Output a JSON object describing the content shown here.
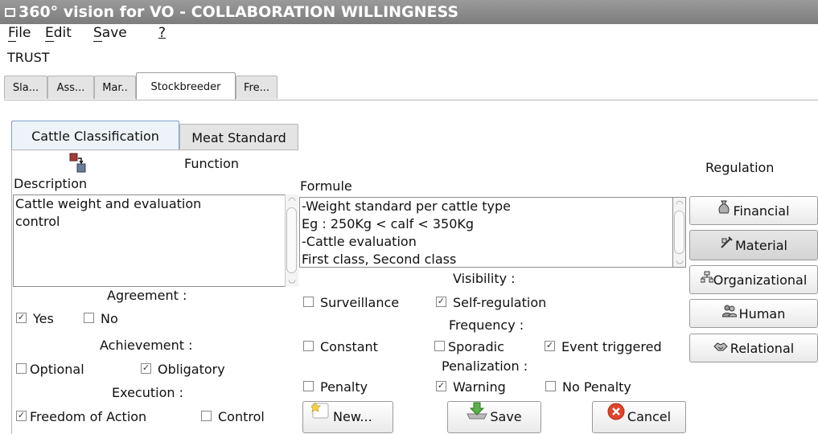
{
  "window": {
    "title": "360° vision for VO - COLLABORATION WILLINGNESS"
  },
  "menu": {
    "file": "File",
    "edit": "Edit",
    "save": "Save",
    "help": "?"
  },
  "section_title": "TRUST",
  "actor_tabs": [
    "Sla...",
    "Ass...",
    "Mar..",
    "Stockbreeder",
    "Fre..."
  ],
  "rule_tabs": [
    "Cattle Classification",
    "Meat Standard"
  ],
  "left": {
    "function_label": "Function",
    "description_label": "Description",
    "description_text": "Cattle weight and evaluation\ncontrol",
    "agreement_label": "Agreement :",
    "agreement": [
      {
        "label": "Yes",
        "checked": true
      },
      {
        "label": "No",
        "checked": false
      }
    ],
    "achievement_label": "Achievement :",
    "achievement": [
      {
        "label": "Optional",
        "checked": false
      },
      {
        "label": "Obligatory",
        "checked": true
      }
    ],
    "execution_label": "Execution :",
    "execution": [
      {
        "label": "Freedom of Action",
        "checked": true
      },
      {
        "label": "Control",
        "checked": false
      }
    ]
  },
  "middle": {
    "formule_label": "Formule",
    "formule_text": "-Weight standard per cattle type\nEg : 250Kg < calf < 350Kg\n-Cattle evaluation\nFirst class, Second class",
    "visibility_label": "Visibility :",
    "visibility": [
      {
        "label": "Surveillance",
        "checked": false
      },
      {
        "label": "Self-regulation",
        "checked": true
      }
    ],
    "frequency_label": "Frequency :",
    "frequency": [
      {
        "label": "Constant",
        "checked": false
      },
      {
        "label": "Sporadic",
        "checked": false
      },
      {
        "label": "Event triggered",
        "checked": true
      }
    ],
    "penalization_label": "Penalization :",
    "penalization": [
      {
        "label": "Penalty",
        "checked": false
      },
      {
        "label": "Warning",
        "checked": true
      },
      {
        "label": "No Penalty",
        "checked": false
      }
    ]
  },
  "regulation": {
    "label": "Regulation",
    "buttons": [
      "Financial",
      "Material",
      "Organizational",
      "Human",
      "Relational"
    ],
    "selected": "Material"
  },
  "actions": {
    "new": "New...",
    "save": "Save",
    "cancel": "Cancel"
  },
  "colors": {
    "titlebar": "#888888",
    "tab_active_border": "#7ba0c8",
    "cancel_icon": "#e0442a",
    "save_icon": "#3a9a3a"
  }
}
